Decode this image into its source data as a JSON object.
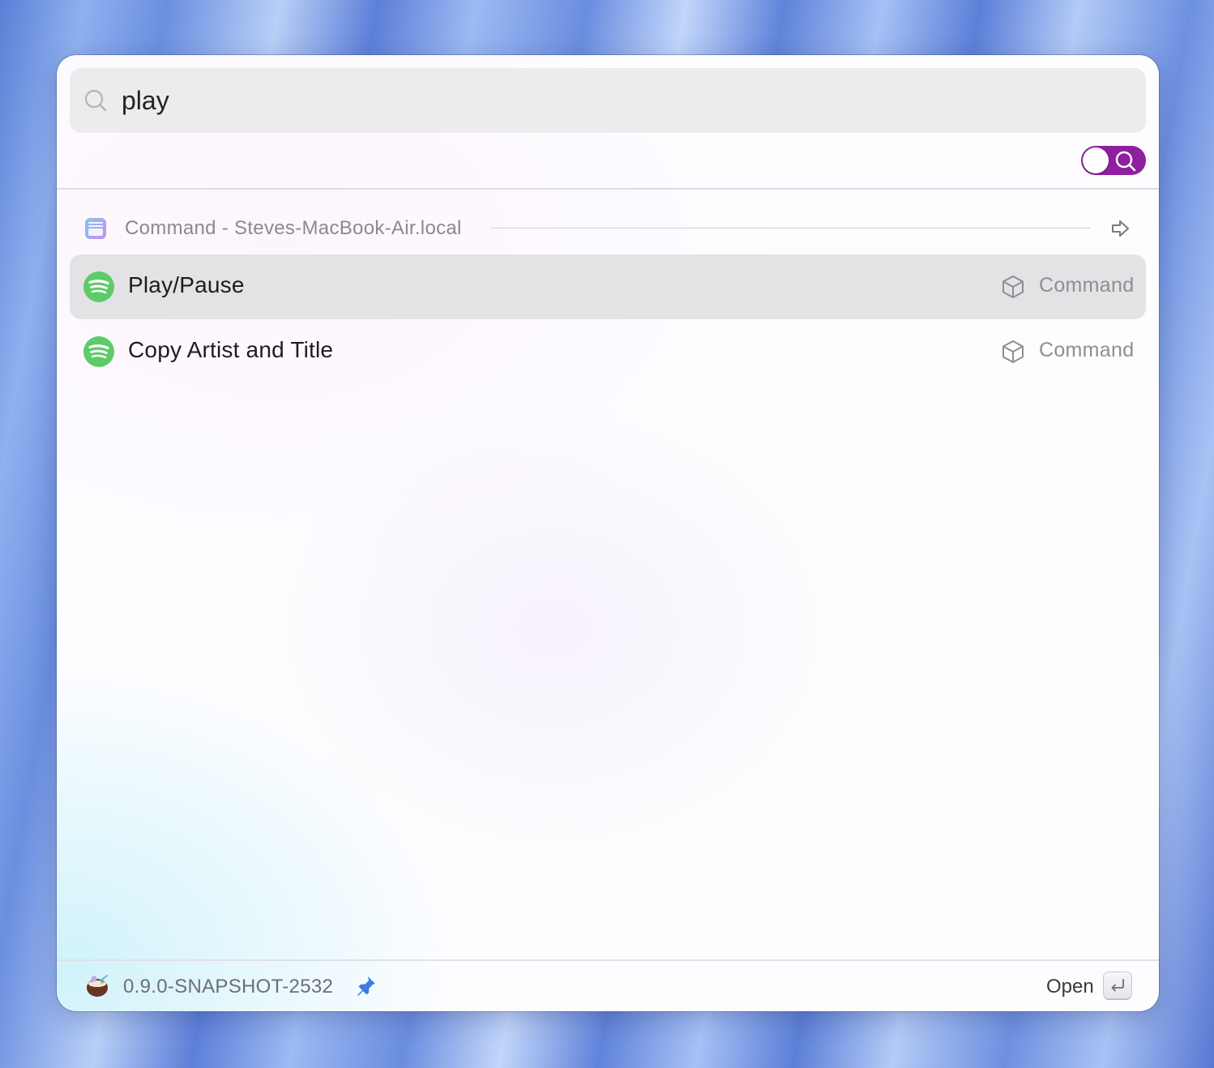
{
  "search": {
    "value": "play",
    "icon": "search-icon"
  },
  "toggle": {
    "state": "on",
    "color": "#8e1fa0",
    "icon": "search-icon"
  },
  "section": {
    "title": "Command - Steves-MacBook-Air.local",
    "icon": "app-window-icon",
    "action_icon": "arrow-right-icon"
  },
  "results": [
    {
      "label": "Play/Pause",
      "type": "Command",
      "app_icon": "spotify-icon",
      "type_icon": "cube-icon",
      "selected": true
    },
    {
      "label": "Copy Artist and Title",
      "type": "Command",
      "app_icon": "spotify-icon",
      "type_icon": "cube-icon",
      "selected": false
    }
  ],
  "footer": {
    "logo_icon": "coconut-icon",
    "version": "0.9.0-SNAPSHOT-2532",
    "pin_icon": "pin-icon",
    "action_label": "Open",
    "action_key_icon": "enter-key-icon"
  },
  "colors": {
    "accent": "#8e1fa0",
    "spotify_green": "#5ecb6b",
    "pin_blue": "#3d7ce0",
    "selected_row": "#e3e3e5"
  }
}
